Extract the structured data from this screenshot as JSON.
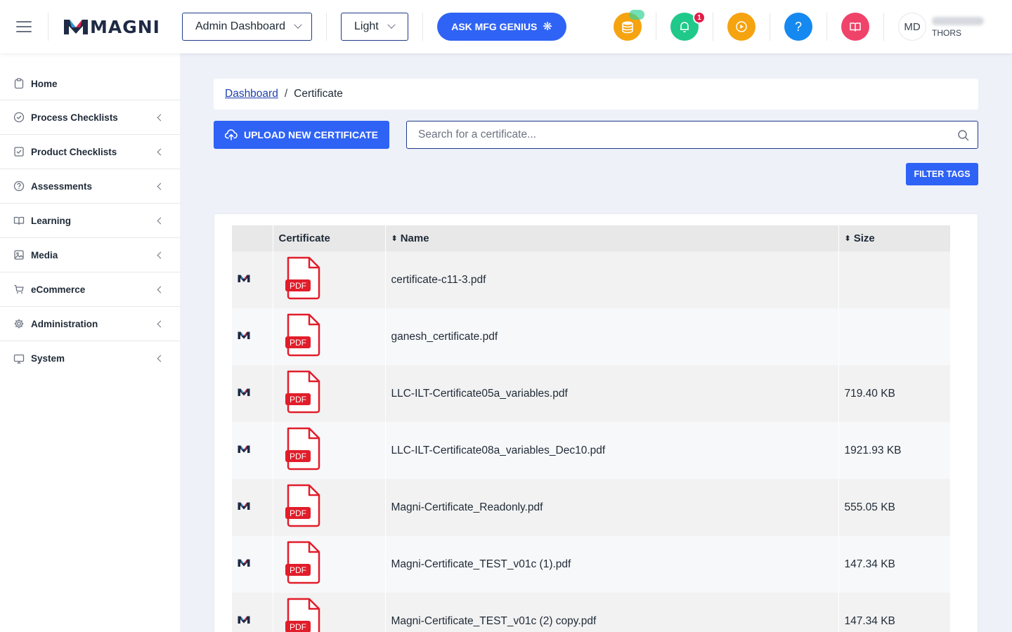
{
  "header": {
    "brand": "MAGNI",
    "dashboard_select": "Admin Dashboard",
    "theme_select": "Light",
    "ask_button": "ASK MFG GENIUS",
    "notification_count": "1",
    "help_label": "?",
    "avatar_initials": "MD",
    "user_org": "THORS",
    "icons": [
      "menu-icon",
      "coins-icon",
      "bell-icon",
      "play-icon",
      "help-icon",
      "book-icon"
    ],
    "colors": {
      "coins": "#f5a30f",
      "bell": "#1fc98a",
      "play": "#f5a30f",
      "help": "#1589f0",
      "book": "#f0436a",
      "primary": "#2f63f5"
    }
  },
  "sidebar": {
    "items": [
      {
        "label": "Home",
        "icon": "clipboard-icon",
        "has_children": false
      },
      {
        "label": "Process Checklists",
        "icon": "check-circle-icon",
        "has_children": true
      },
      {
        "label": "Product Checklists",
        "icon": "check-square-icon",
        "has_children": true
      },
      {
        "label": "Assessments",
        "icon": "question-circle-icon",
        "has_children": true
      },
      {
        "label": "Learning",
        "icon": "book-open-icon",
        "has_children": true
      },
      {
        "label": "Media",
        "icon": "image-icon",
        "has_children": true
      },
      {
        "label": "eCommerce",
        "icon": "cart-icon",
        "has_children": true
      },
      {
        "label": "Administration",
        "icon": "gear-icon",
        "has_children": true
      },
      {
        "label": "System",
        "icon": "monitor-icon",
        "has_children": true
      }
    ]
  },
  "breadcrumb": {
    "parent": "Dashboard",
    "separator": "/",
    "current": "Certificate"
  },
  "toolbar": {
    "upload_label": "UPLOAD NEW CERTIFICATE",
    "search_placeholder": "Search for a certificate...",
    "filter_label": "FILTER TAGS"
  },
  "table": {
    "headers": {
      "certificate": "Certificate",
      "name": "Name",
      "size": "Size"
    },
    "pdf_label": "PDF",
    "rows": [
      {
        "name": "certificate-c11-3.pdf",
        "size": ""
      },
      {
        "name": "ganesh_certificate.pdf",
        "size": ""
      },
      {
        "name": "LLC-ILT-Certificate05a_variables.pdf",
        "size": "719.40 KB"
      },
      {
        "name": "LLC-ILT-Certificate08a_variables_Dec10.pdf",
        "size": "1921.93 KB"
      },
      {
        "name": "Magni-Certificate_Readonly.pdf",
        "size": "555.05 KB"
      },
      {
        "name": "Magni-Certificate_TEST_v01c (1).pdf",
        "size": "147.34 KB"
      },
      {
        "name": "Magni-Certificate_TEST_v01c (2) copy.pdf",
        "size": "147.34 KB"
      }
    ]
  }
}
